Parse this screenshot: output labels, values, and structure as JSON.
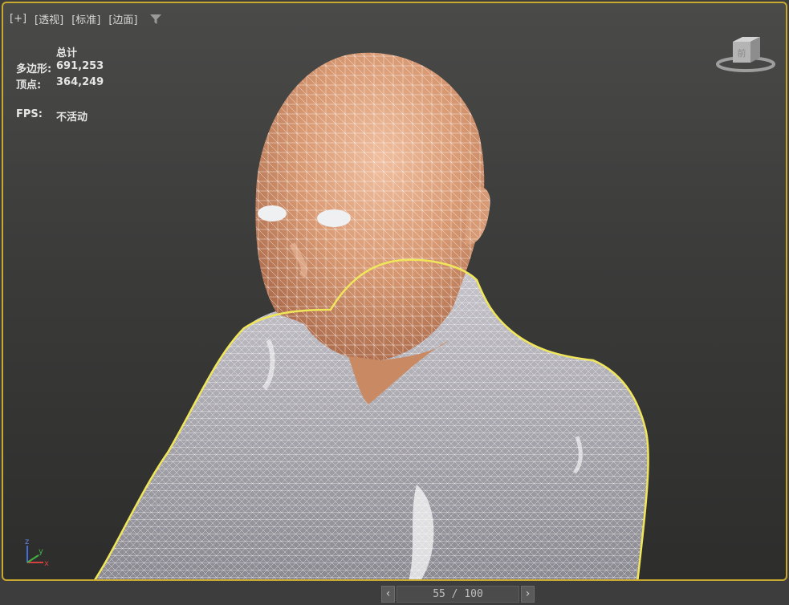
{
  "viewport": {
    "labels": [
      "[+]",
      "[透视]",
      "[标准]",
      "[边面]"
    ],
    "filter_icon": "filter-icon"
  },
  "stats": {
    "header": "总计",
    "polygons_label": "多边形:",
    "polygons_value": "691,253",
    "vertices_label": "顶点:",
    "vertices_value": "364,249",
    "fps_label": "FPS:",
    "fps_value": "不活动"
  },
  "viewcube": {
    "face_label": "前"
  },
  "axis_tripod": {
    "z_label": "z",
    "x_label": "x",
    "y_label": "y"
  },
  "pager": {
    "prev_icon": "chevron-left-icon",
    "next_icon": "chevron-right-icon",
    "text": "55 / 100"
  },
  "colors": {
    "selection_outline": "#f0e65a",
    "viewport_border": "#c9a92e",
    "wireframe": "#ffffff",
    "skin": "#d99a73"
  }
}
